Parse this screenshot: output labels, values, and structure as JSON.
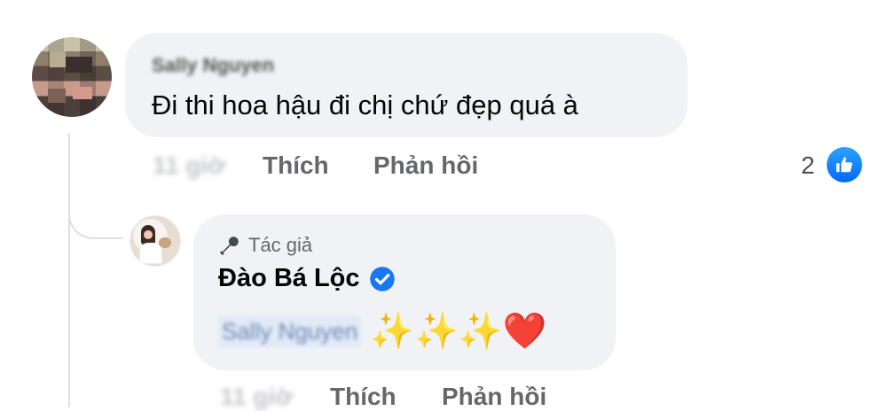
{
  "comment": {
    "author_name": "Sally Nguyen",
    "text": "Đi thi hoa hậu đi chị chứ đẹp quá à",
    "time": "11 giờ",
    "actions": {
      "like": "Thích",
      "reply": "Phản hồi"
    },
    "reaction_count": "2",
    "reaction_icon": "like-icon",
    "reaction_color": "#1877f2"
  },
  "reply": {
    "badge_icon": "microphone-icon",
    "badge_label": "Tác giả",
    "author_name": "Đào Bá Lộc",
    "verified_icon": "verified-badge-icon",
    "mention": "Sally Nguyen",
    "emojis": "✨✨✨❤️",
    "time": "11 giờ",
    "actions": {
      "like": "Thích",
      "reply": "Phản hồi"
    }
  },
  "colors": {
    "bubble_bg": "#f0f2f5",
    "meta_text": "#65676b",
    "verified_blue": "#1877f2"
  }
}
